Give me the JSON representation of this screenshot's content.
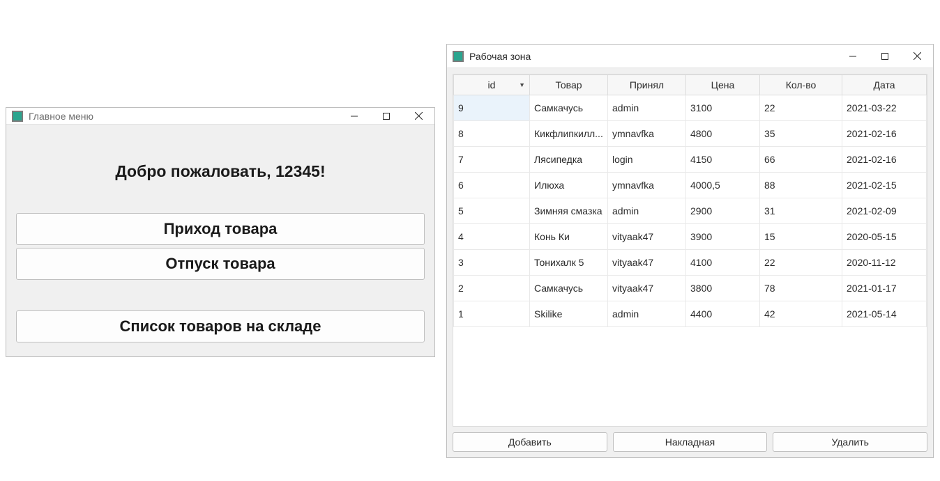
{
  "main_menu": {
    "title": "Главное меню",
    "welcome": "Добро пожаловать, 12345!",
    "buttons": {
      "incoming": "Приход товара",
      "outgoing": "Отпуск товара",
      "stock_list": "Список товаров на складе"
    }
  },
  "work_zone": {
    "title": "Рабочая зона",
    "columns": {
      "id": "id",
      "item": "Товар",
      "accepted_by": "Принял",
      "price": "Цена",
      "qty": "Кол-во",
      "date": "Дата"
    },
    "sort": {
      "column": "id",
      "direction": "desc"
    },
    "rows": [
      {
        "id": "9",
        "item": "Самкачусь",
        "accepted_by": "admin",
        "price": "3100",
        "qty": "22",
        "date": "2021-03-22"
      },
      {
        "id": "8",
        "item": "Кикфлипкилл...",
        "accepted_by": "ymnavfka",
        "price": "4800",
        "qty": "35",
        "date": "2021-02-16"
      },
      {
        "id": "7",
        "item": "Лясипедка",
        "accepted_by": "login",
        "price": "4150",
        "qty": "66",
        "date": "2021-02-16"
      },
      {
        "id": "6",
        "item": "Илюха",
        "accepted_by": "ymnavfka",
        "price": "4000,5",
        "qty": "88",
        "date": "2021-02-15"
      },
      {
        "id": "5",
        "item": "Зимняя смазка",
        "accepted_by": "admin",
        "price": "2900",
        "qty": "31",
        "date": "2021-02-09"
      },
      {
        "id": "4",
        "item": "Конь Ки",
        "accepted_by": "vityaak47",
        "price": "3900",
        "qty": "15",
        "date": "2020-05-15"
      },
      {
        "id": "3",
        "item": "Тонихалк 5",
        "accepted_by": "vityaak47",
        "price": "4100",
        "qty": "22",
        "date": "2020-11-12"
      },
      {
        "id": "2",
        "item": "Самкачусь",
        "accepted_by": "vityaak47",
        "price": "3800",
        "qty": "78",
        "date": "2021-01-17"
      },
      {
        "id": "1",
        "item": "Skilike",
        "accepted_by": "admin",
        "price": "4400",
        "qty": "42",
        "date": "2021-05-14"
      }
    ],
    "buttons": {
      "add": "Добавить",
      "invoice": "Накладная",
      "delete": "Удалить"
    }
  }
}
